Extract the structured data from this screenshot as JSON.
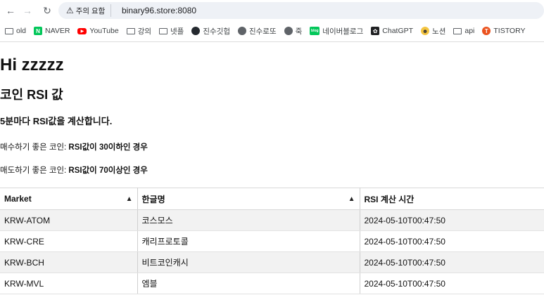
{
  "browser": {
    "nav": {
      "back_icon": "arrow-left-icon",
      "forward_icon": "arrow-right-icon",
      "reload_icon": "reload-icon"
    },
    "security_warning": "주의 요함",
    "url": "binary96.store:8080",
    "bookmarks": [
      {
        "label": "old",
        "icon": "folder-icon"
      },
      {
        "label": "NAVER",
        "icon": "naver-icon"
      },
      {
        "label": "YouTube",
        "icon": "youtube-icon"
      },
      {
        "label": "강의",
        "icon": "folder-icon"
      },
      {
        "label": "넷플",
        "icon": "folder-icon"
      },
      {
        "label": "진수깃헙",
        "icon": "github-icon"
      },
      {
        "label": "진수로또",
        "icon": "globe-icon"
      },
      {
        "label": "죽",
        "icon": "globe-icon"
      },
      {
        "label": "네이버블로그",
        "icon": "blog-icon"
      },
      {
        "label": "ChatGPT",
        "icon": "chatgpt-icon"
      },
      {
        "label": "노션",
        "icon": "notion-icon"
      },
      {
        "label": "api",
        "icon": "folder-icon"
      },
      {
        "label": "TISTORY",
        "icon": "tistory-icon"
      }
    ]
  },
  "page": {
    "greeting": "Hi zzzzz",
    "subtitle": "코인 RSI 값",
    "description": "5분마다 RSI값을 계산합니다.",
    "buy_rule": {
      "prefix": "매수하기 좋은 코인: ",
      "highlight": "RSI값이 30이하인 경우"
    },
    "sell_rule": {
      "prefix": "매도하기 좋은 코인: ",
      "highlight": "RSI값이 70이상인 경우"
    }
  },
  "table": {
    "columns": [
      "Market",
      "한글명",
      "RSI 계산 시간"
    ],
    "sort_icon": "sort-icon",
    "rows": [
      [
        "KRW-ATOM",
        "코스모스",
        "2024-05-10T00:47:50"
      ],
      [
        "KRW-CRE",
        "캐리프로토콜",
        "2024-05-10T00:47:50"
      ],
      [
        "KRW-BCH",
        "비트코인캐시",
        "2024-05-10T00:47:50"
      ],
      [
        "KRW-MVL",
        "엠블",
        "2024-05-10T00:47:50"
      ]
    ]
  }
}
